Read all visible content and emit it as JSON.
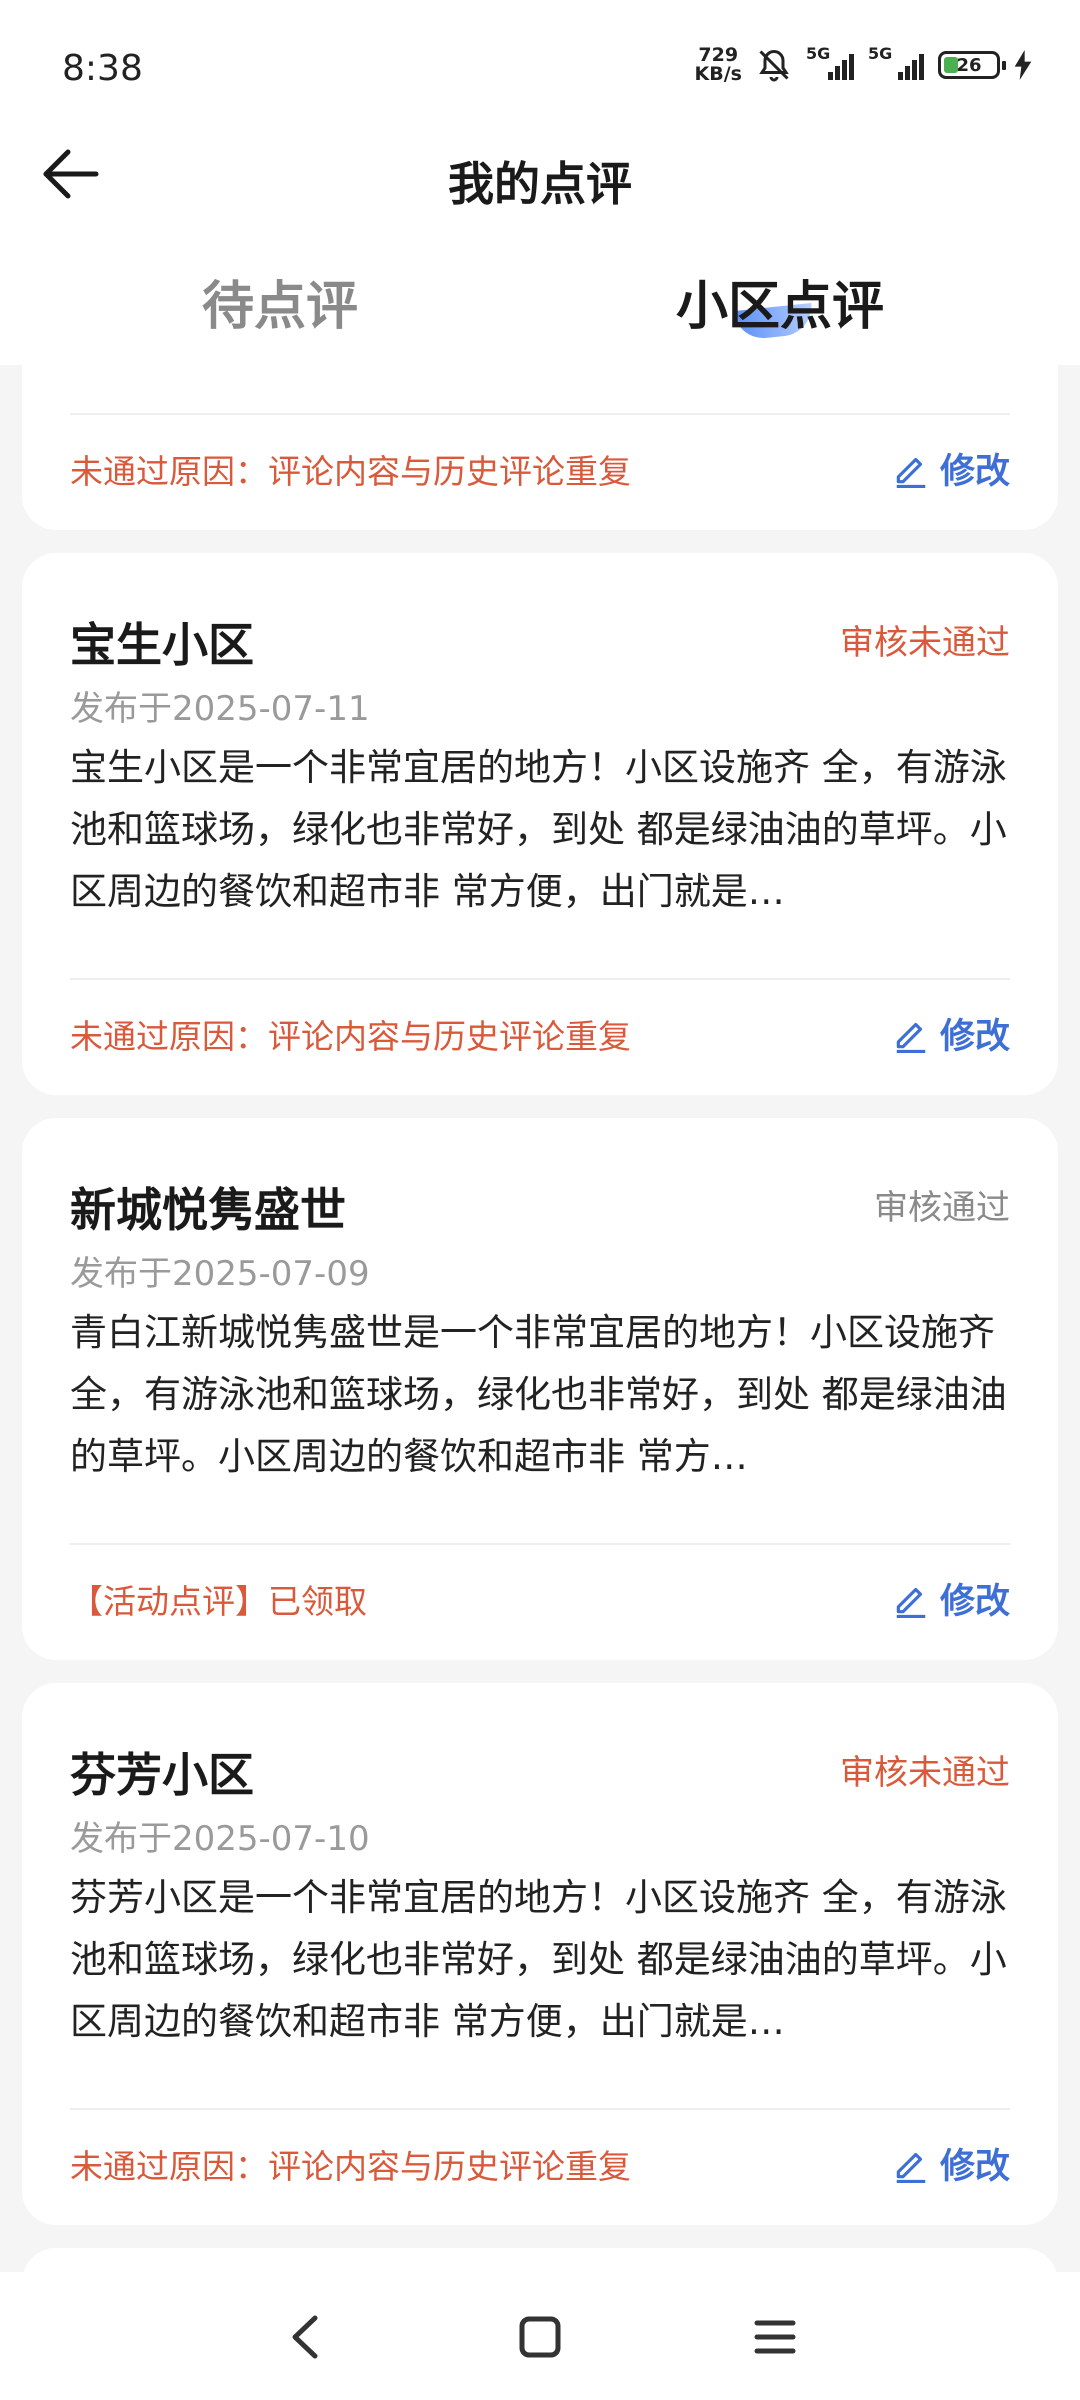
{
  "status_bar": {
    "time": "8:38",
    "speed_value": "729",
    "speed_unit": "KB/s",
    "signal_1_label": "5G",
    "signal_2_label": "5G",
    "battery_level": "26",
    "icons": [
      "bell-off-icon",
      "signal-icon",
      "signal-icon",
      "battery-icon",
      "charging-icon"
    ]
  },
  "header": {
    "title": "我的点评",
    "back_icon": "arrow-left-icon"
  },
  "tabs": [
    {
      "label": "待点评",
      "active": false
    },
    {
      "label": "小区点评",
      "active": true
    }
  ],
  "colors": {
    "fail": "#d9593a",
    "pass": "#8a8a8a",
    "accent": "#3d6fd6"
  },
  "edit_label": "修改",
  "partial_card": {
    "note": "未通过原因：评论内容与历史评论重复"
  },
  "cards": [
    {
      "name": "宝生小区",
      "status": "审核未通过",
      "date": "发布于2025-07-11",
      "content": "宝生小区是一个非常宜居的地方！小区设施齐 全，有游泳池和篮球场，绿化也非常好，到处 都是绿油油的草坪。小区周边的餐饮和超市非 常方便，出门就是…",
      "note": "未通过原因：评论内容与历史评论重复"
    },
    {
      "name": "新城悦隽盛世",
      "status": "审核通过",
      "date": "发布于2025-07-09",
      "content": "青白江新城悦隽盛世是一个非常宜居的地方！小区设施齐 全，有游泳池和篮球场，绿化也非常好，到处 都是绿油油的草坪。小区周边的餐饮和超市非 常方…",
      "note": "【活动点评】已领取"
    },
    {
      "name": "芬芳小区",
      "status": "审核未通过",
      "date": "发布于2025-07-10",
      "content": "芬芳小区是一个非常宜居的地方！小区设施齐 全，有游泳池和篮球场，绿化也非常好，到处 都是绿油油的草坪。小区周边的餐饮和超市非 常方便，出门就是…",
      "note": "未通过原因：评论内容与历史评论重复"
    }
  ],
  "nav_bar": [
    "back-nav-icon",
    "home-nav-icon",
    "menu-nav-icon"
  ]
}
